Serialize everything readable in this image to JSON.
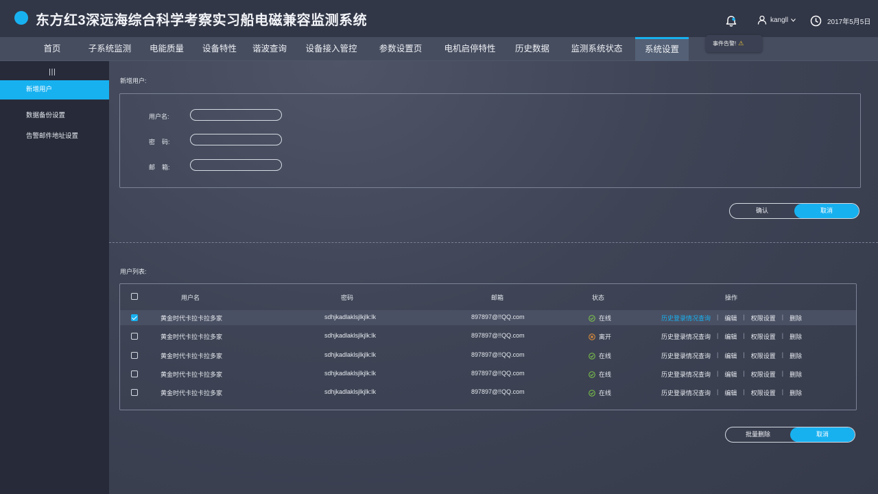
{
  "app": {
    "title": "东方红3深远海综合科学考察实习船电磁兼容监测系统",
    "user": "kangll",
    "date": "2017年5月5日",
    "brand_color": "#18b1f0"
  },
  "nav": {
    "tabs": [
      "首页",
      "子系统监测",
      "电能质量",
      "设备特性",
      "谐波查询",
      "设备接入管控",
      "参数设置页",
      "电机启停特性",
      "历史数据",
      "监测系统状态",
      "系统设置"
    ],
    "active": "系统设置"
  },
  "tooltip": {
    "text": "事件告警!",
    "icon": "warning-icon"
  },
  "sidebar": {
    "items": [
      "新增用户",
      "数据备份设置",
      "告警邮件地址设置"
    ],
    "active": "新增用户"
  },
  "new_user": {
    "section_title": "新增用户:",
    "fields": [
      {
        "label": "用户名:",
        "value": "",
        "placeholder": ""
      },
      {
        "label": "密    码:",
        "value": "",
        "placeholder": ""
      },
      {
        "label": "邮    箱:",
        "value": "",
        "placeholder": ""
      }
    ],
    "confirm_label": "确认",
    "cancel_label": "取消"
  },
  "user_list": {
    "section_title": "用户列表:",
    "columns": [
      "用户名",
      "密码",
      "邮箱",
      "状态",
      "操作"
    ],
    "rows": [
      {
        "checked": true,
        "username": "黄金时代卡拉卡拉多家",
        "password": "sdhjkadlaklsjlkjlk:lk",
        "email": "897897@!!QQ.com",
        "status": "在线",
        "status_kind": "online"
      },
      {
        "checked": false,
        "username": "黄金时代卡拉卡拉多家",
        "password": "sdhjkadlaklsjlkjlk:lk",
        "email": "897897@!!QQ.com",
        "status": "离开",
        "status_kind": "away"
      },
      {
        "checked": false,
        "username": "黄金时代卡拉卡拉多家",
        "password": "sdhjkadlaklsjlkjlk:lk",
        "email": "897897@!!QQ.com",
        "status": "在线",
        "status_kind": "online"
      },
      {
        "checked": false,
        "username": "黄金时代卡拉卡拉多家",
        "password": "sdhjkadlaklsjlkjlk:lk",
        "email": "897897@!!QQ.com",
        "status": "在线",
        "status_kind": "online"
      },
      {
        "checked": false,
        "username": "黄金时代卡拉卡拉多家",
        "password": "sdhjkadlaklsjlkjlk:lk",
        "email": "897897@!!QQ.com",
        "status": "在线",
        "status_kind": "online"
      }
    ],
    "actions": [
      "历史登录情况查询",
      "编辑",
      "权限设置",
      "删除"
    ],
    "batch_delete_label": "批量删除",
    "cancel_label": "取消"
  },
  "colors": {
    "online": "#7fc94a",
    "away": "#e8903a",
    "accent": "#18b1f0"
  }
}
